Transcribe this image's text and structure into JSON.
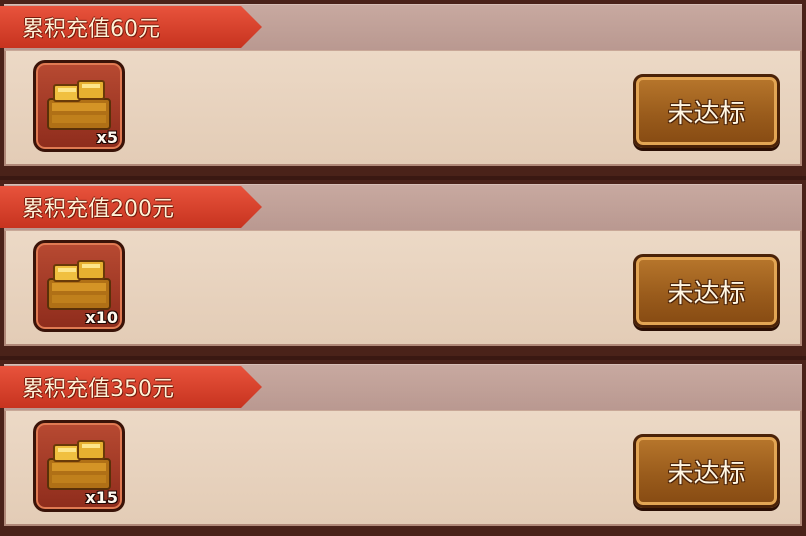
{
  "tiers": [
    {
      "title": "累积充值60元",
      "reward": {
        "icon": "gold-bars-icon",
        "quantity": "x5"
      },
      "status_label": "未达标"
    },
    {
      "title": "累积充值200元",
      "reward": {
        "icon": "gold-bars-icon",
        "quantity": "x10"
      },
      "status_label": "未达标"
    },
    {
      "title": "累积充值350元",
      "reward": {
        "icon": "gold-bars-icon",
        "quantity": "x15"
      },
      "status_label": "未达标"
    }
  ],
  "colors": {
    "ribbon": "#d6402a",
    "button": "#9a5c1c",
    "card_body": "#e8d4c0"
  }
}
